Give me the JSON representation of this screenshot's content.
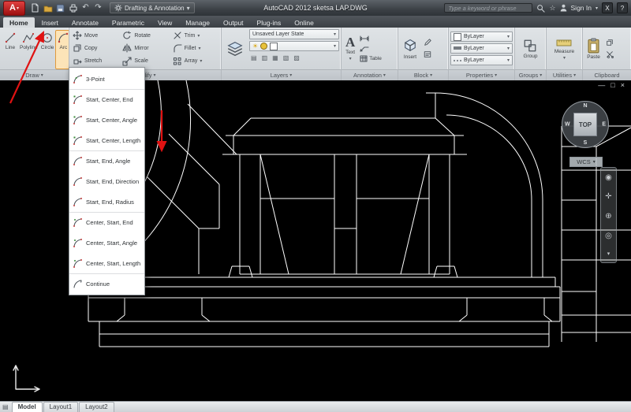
{
  "titlebar": {
    "logo": "A",
    "workspace": "Drafting & Annotation",
    "title": "AutoCAD 2012   sketsa LAP.DWG",
    "search_placeholder": "Type a keyword or phrase",
    "sign_in": "Sign In",
    "exchange": "X",
    "help": "?"
  },
  "ribbon": {
    "tabs": [
      "Home",
      "Insert",
      "Annotate",
      "Parametric",
      "View",
      "Manage",
      "Output",
      "Plug-ins",
      "Online"
    ],
    "active_tab": "Home",
    "draw": {
      "label": "Draw",
      "tools": [
        "Line",
        "Polyline",
        "Circle",
        "Arc"
      ]
    },
    "modify": {
      "label": "Modify",
      "tools": [
        "Move",
        "Rotate",
        "Trim",
        "Copy",
        "Mirror",
        "Fillet",
        "Stretch",
        "Scale",
        "Array"
      ]
    },
    "layers": {
      "label": "Layers",
      "state": "Unsaved Layer State"
    },
    "annotation": {
      "label": "Annotation",
      "text_tool": "Text",
      "table_tool": "Table"
    },
    "block": {
      "label": "Block",
      "insert_tool": "Insert"
    },
    "properties": {
      "label": "Properties",
      "rows": [
        "ByLayer",
        "ByLayer",
        "ByLayer"
      ]
    },
    "groups": {
      "label": "Groups",
      "group_tool": "Group"
    },
    "utilities": {
      "label": "Utilities",
      "measure_tool": "Measure"
    },
    "clipboard": {
      "label": "Clipboard",
      "paste_tool": "Paste"
    }
  },
  "arc_menu": {
    "items": [
      "3-Point",
      "Start, Center, End",
      "Start, Center, Angle",
      "Start, Center, Length",
      "Start, End, Angle",
      "Start, End, Direction",
      "Start, End, Radius",
      "Center, Start, End",
      "Center, Start, Angle",
      "Center, Start, Length",
      "Continue"
    ]
  },
  "viewcube": {
    "north": "N",
    "south": "S",
    "east": "E",
    "west": "W",
    "face": "TOP",
    "coord_system": "WCS"
  },
  "layout_tabs": [
    "Model",
    "Layout1",
    "Layout2"
  ],
  "active_layout_tab": "Model",
  "icons": {
    "chevron_down": "▾",
    "minimize": "—",
    "restore": "□",
    "close": "×",
    "undo": "↶",
    "redo": "↷",
    "star": "☆",
    "grid": "▤"
  },
  "colors": {
    "arrow_red": "#e01212",
    "canvas_bg": "#000000",
    "line_white": "#ffffff",
    "logo_red": "#b01212"
  }
}
